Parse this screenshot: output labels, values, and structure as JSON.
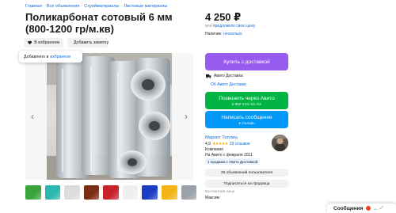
{
  "breadcrumbs": [
    "Главная",
    "Все объявления",
    "Стройматериалы",
    "Листовые материалы"
  ],
  "title": "Поликарбонат сотовый 6 мм (800-1200 гр/м.кв)",
  "actions": {
    "favorite_label": "В избранном",
    "note_label": "Добавить заметку"
  },
  "toast": {
    "text": "Добавлено в",
    "link": "избранное"
  },
  "price": {
    "value": "4 250 ₽",
    "hint_prefix": "или",
    "hint_link": "предложите свою цену"
  },
  "availability": {
    "label": "Наличие:",
    "value": "несколько"
  },
  "buttons": {
    "buy_label": "Купить с доставкой",
    "call_label": "Позвонить через Авито",
    "call_number": "8 950 XXX-XX-XX",
    "message_label": "Написать сообщение",
    "message_status": "Онлайн"
  },
  "delivery": {
    "label": "Авито Доставка",
    "link": "Об Авито Доставке"
  },
  "seller": {
    "name": "Маркет Теплиц",
    "rating": "4,9",
    "stars": "★★★★★",
    "reviews": "29 отзывов",
    "type": "Компания",
    "since": "На Авито с февраля 2011",
    "badge": "1 продажа с Авито Доставкой"
  },
  "seller_buttons": {
    "listings": "36 объявлений пользователя",
    "subscribe": "Подписаться на продавца"
  },
  "contact": {
    "label": "Контактное лицо",
    "name": "Максим"
  },
  "messages_bar": {
    "label": "Сообщения"
  },
  "colors": {
    "buy": "#975bf0",
    "call": "#02b444",
    "message": "#0099f7",
    "link": "#0a6dd9"
  },
  "thumbnails": [
    {
      "name": "thumb-green-sheet",
      "color": "#3aa33a"
    },
    {
      "name": "thumb-teal-sheet",
      "color": "#2cb7b0"
    },
    {
      "name": "thumb-clear-sheet",
      "color": "#dcdcdc"
    },
    {
      "name": "thumb-brown-sheet",
      "color": "#7a2d14"
    },
    {
      "name": "thumb-red-sheet",
      "color": "#c8232b"
    },
    {
      "name": "thumb-white-sheet",
      "color": "#efefef"
    },
    {
      "name": "thumb-blue-sheet",
      "color": "#1a3fc4"
    },
    {
      "name": "thumb-yellow-sheet",
      "color": "#f2b514"
    },
    {
      "name": "thumb-gray-sheet",
      "color": "#9aa1a8"
    }
  ]
}
